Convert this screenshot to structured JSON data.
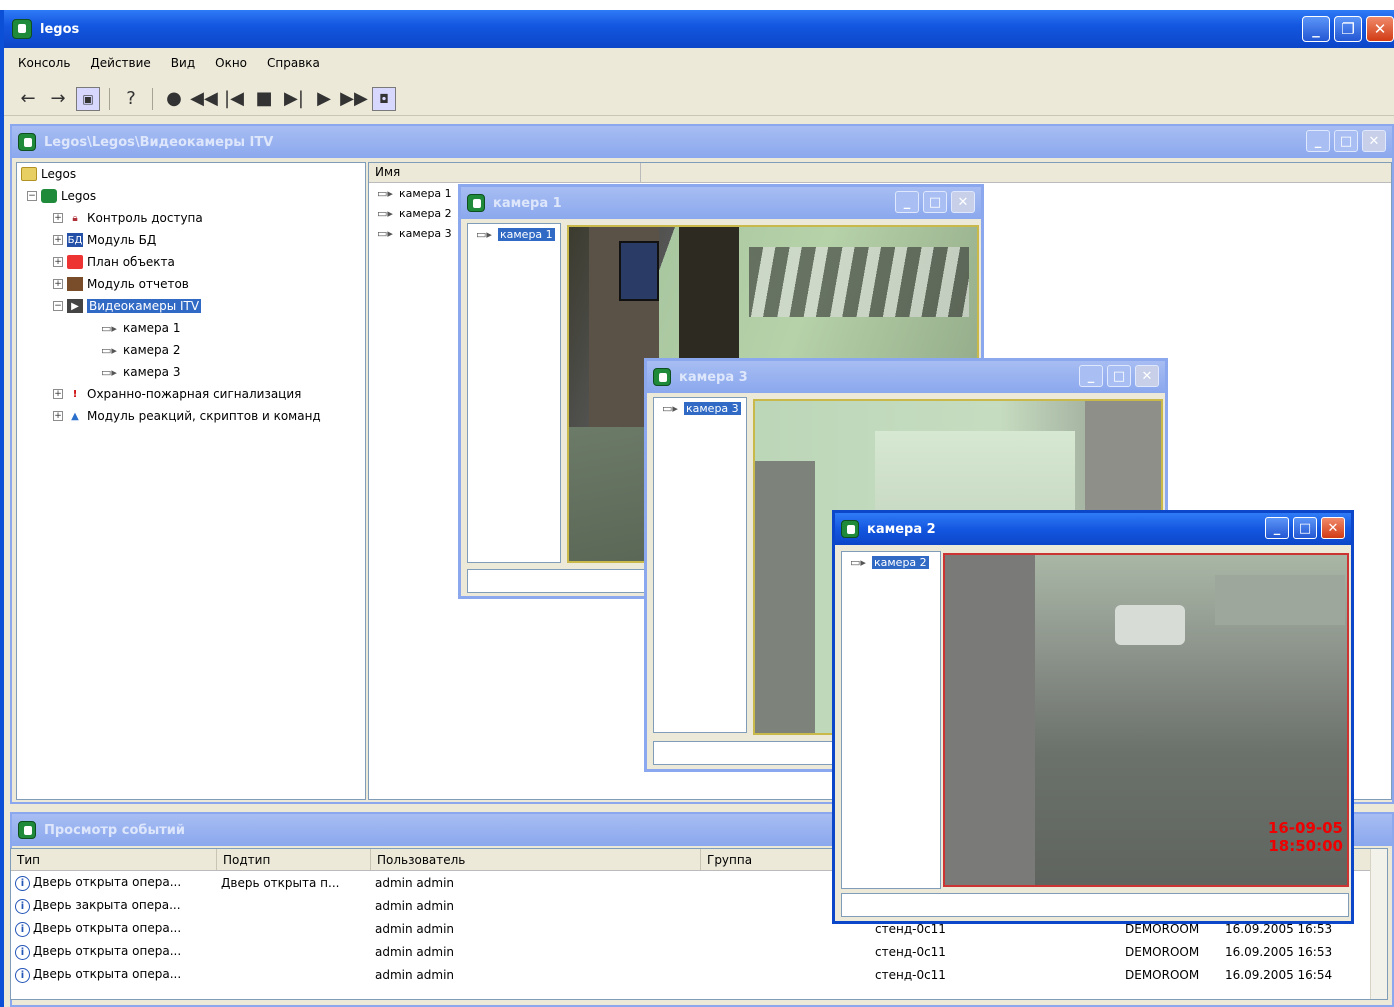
{
  "app": {
    "title": "legos"
  },
  "menu": [
    "Консоль",
    "Действие",
    "Вид",
    "Окно",
    "Справка"
  ],
  "tree_window": {
    "title": "Legos\\Legos\\Видеокамеры ITV",
    "root": "Legos",
    "node": "Legos",
    "items": [
      {
        "label": "Контроль доступа",
        "icon": "lock-icon"
      },
      {
        "label": "Модуль БД",
        "icon": "database-icon"
      },
      {
        "label": "План объекта",
        "icon": "map-icon"
      },
      {
        "label": "Модуль отчетов",
        "icon": "report-icon"
      },
      {
        "label": "Видеокамеры ITV",
        "icon": "video-icon",
        "selected": true
      },
      {
        "label": "камера 1",
        "icon": "camera-icon",
        "child": true
      },
      {
        "label": "камера 2",
        "icon": "camera-icon",
        "child": true
      },
      {
        "label": "камера 3",
        "icon": "camera-icon",
        "child": true
      },
      {
        "label": "Охранно-пожарная сигнализация",
        "icon": "alarm-icon"
      },
      {
        "label": "Модуль реакций, скриптов и команд",
        "icon": "script-icon"
      }
    ],
    "list_header": "Имя",
    "list_items": [
      "камера 1",
      "камера 2",
      "камера 3"
    ]
  },
  "cam1": {
    "title": "камера 1",
    "item": "камера 1"
  },
  "cam3": {
    "title": "камера 3",
    "item": "камера 3"
  },
  "cam2": {
    "title": "камера 2",
    "item": "камера 2",
    "stamp_date": "16-09-05",
    "stamp_time": "18:50:00"
  },
  "events": {
    "title": "Просмотр событий",
    "columns": [
      "Тип",
      "Подтип",
      "Пользователь",
      "Группа"
    ],
    "rows": [
      {
        "type": "Дверь открыта опера...",
        "subtype": "Дверь открыта п...",
        "user": "admin admin",
        "group": "",
        "host": "",
        "room": "",
        "time": ""
      },
      {
        "type": "Дверь закрыта опера...",
        "subtype": "",
        "user": "admin admin",
        "group": "",
        "host": "",
        "room": "",
        "time": ""
      },
      {
        "type": "Дверь открыта опера...",
        "subtype": "",
        "user": "admin admin",
        "group": "",
        "host": "стенд-0с11",
        "room": "DEMOROOM",
        "time": "16.09.2005 16:53"
      },
      {
        "type": "Дверь открыта опера...",
        "subtype": "",
        "user": "admin admin",
        "group": "",
        "host": "стенд-0с11",
        "room": "DEMOROOM",
        "time": "16.09.2005 16:53"
      },
      {
        "type": "Дверь открыта опера...",
        "subtype": "",
        "user": "admin admin",
        "group": "",
        "host": "стенд-0с11",
        "room": "DEMOROOM",
        "time": "16.09.2005 16:54"
      }
    ]
  }
}
